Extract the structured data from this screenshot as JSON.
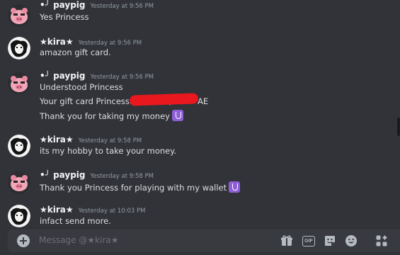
{
  "messages": [
    {
      "author": "•╯ paypig",
      "timestamp": "Yesterday at 9:56 PM",
      "lines": [
        "Yes Princess"
      ]
    },
    {
      "author": "★kira★",
      "timestamp": "Yesterday at 9:56 PM",
      "lines": [
        "amazon gift card."
      ]
    },
    {
      "author": "•╯ paypig",
      "timestamp": "Yesterday at 9:56 PM",
      "lines": [
        "Understood Princess",
        "Your gift card Princess: 6BSQ-8Q",
        "AE",
        "Thank you for taking my money"
      ]
    },
    {
      "author": "★kira★",
      "timestamp": "Yesterday at 9:58 PM",
      "lines": [
        "its my hobby to take your money."
      ]
    },
    {
      "author": "•╯ paypig",
      "timestamp": "Yesterday at 9:58 PM",
      "lines": [
        "Thank you Princess for playing with my wallet"
      ]
    },
    {
      "author": "★kira★",
      "timestamp": "Yesterday at 10:03 PM",
      "lines": [
        "infact send more."
      ]
    }
  ],
  "composer": {
    "placeholder": "Message @★kira★"
  },
  "icons": {
    "attach": "plus-circle-icon",
    "gift": "gift-icon",
    "gif": "gif-icon",
    "sticker": "sticker-icon",
    "emoji": "emoji-icon",
    "apps": "apps-icon",
    "message_emoji": "money-emoji-icon"
  },
  "colors": {
    "background": "#313338",
    "composer": "#383a40",
    "redaction": "#e8181e"
  }
}
